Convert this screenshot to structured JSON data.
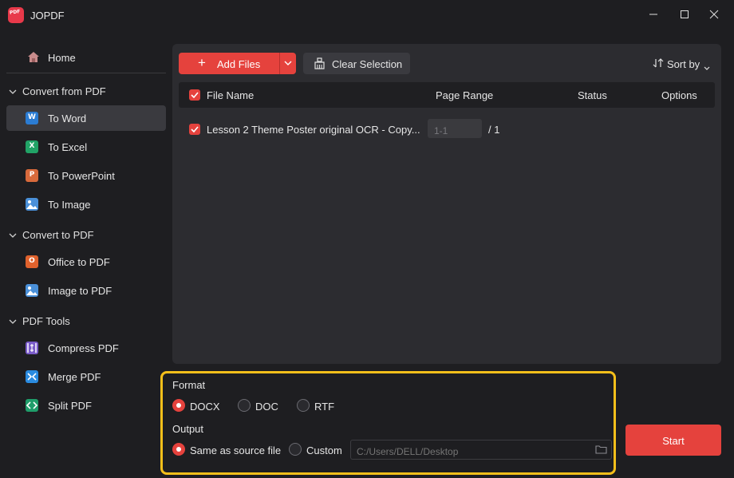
{
  "app": {
    "title": "JOPDF",
    "logo_text": "PDF"
  },
  "sidebar": {
    "home": "Home",
    "sections": [
      {
        "title": "Convert from PDF",
        "items": [
          "To Word",
          "To Excel",
          "To PowerPoint",
          "To Image"
        ]
      },
      {
        "title": "Convert to PDF",
        "items": [
          "Office to PDF",
          "Image to PDF"
        ]
      },
      {
        "title": "PDF Tools",
        "items": [
          "Compress PDF",
          "Merge PDF",
          "Split PDF"
        ]
      }
    ],
    "active_item": "To Word",
    "icon_letters": {
      "word": "W",
      "excel": "X",
      "powerpoint": "P",
      "office": "O"
    },
    "icon_colors": {
      "word": "#2b7cd3",
      "excel": "#21a366",
      "powerpoint": "#d86a3c",
      "image": "#4a90d9",
      "office": "#e0622d",
      "compress": "#7a5cc9",
      "merge": "#2a8be0",
      "split": "#1f9d6a"
    }
  },
  "toolbar": {
    "add_files": "Add Files",
    "clear_selection": "Clear Selection",
    "sort_by": "Sort by"
  },
  "table": {
    "headers": {
      "file_name": "File Name",
      "page_range": "Page Range",
      "status": "Status",
      "options": "Options"
    },
    "rows": [
      {
        "file_name": "Lesson 2 Theme Poster original OCR - Copy...",
        "page_range": "1-1",
        "total": "/ 1",
        "checked": true
      }
    ]
  },
  "format": {
    "label": "Format",
    "options": [
      "DOCX",
      "DOC",
      "RTF"
    ],
    "selected": "DOCX"
  },
  "output": {
    "label": "Output",
    "options": [
      "Same as source file",
      "Custom"
    ],
    "selected": "Same as source file",
    "path_placeholder": "C:/Users/DELL/Desktop"
  },
  "start_button": "Start",
  "colors": {
    "accent": "#e5423d",
    "highlight": "#f5bf1a"
  }
}
